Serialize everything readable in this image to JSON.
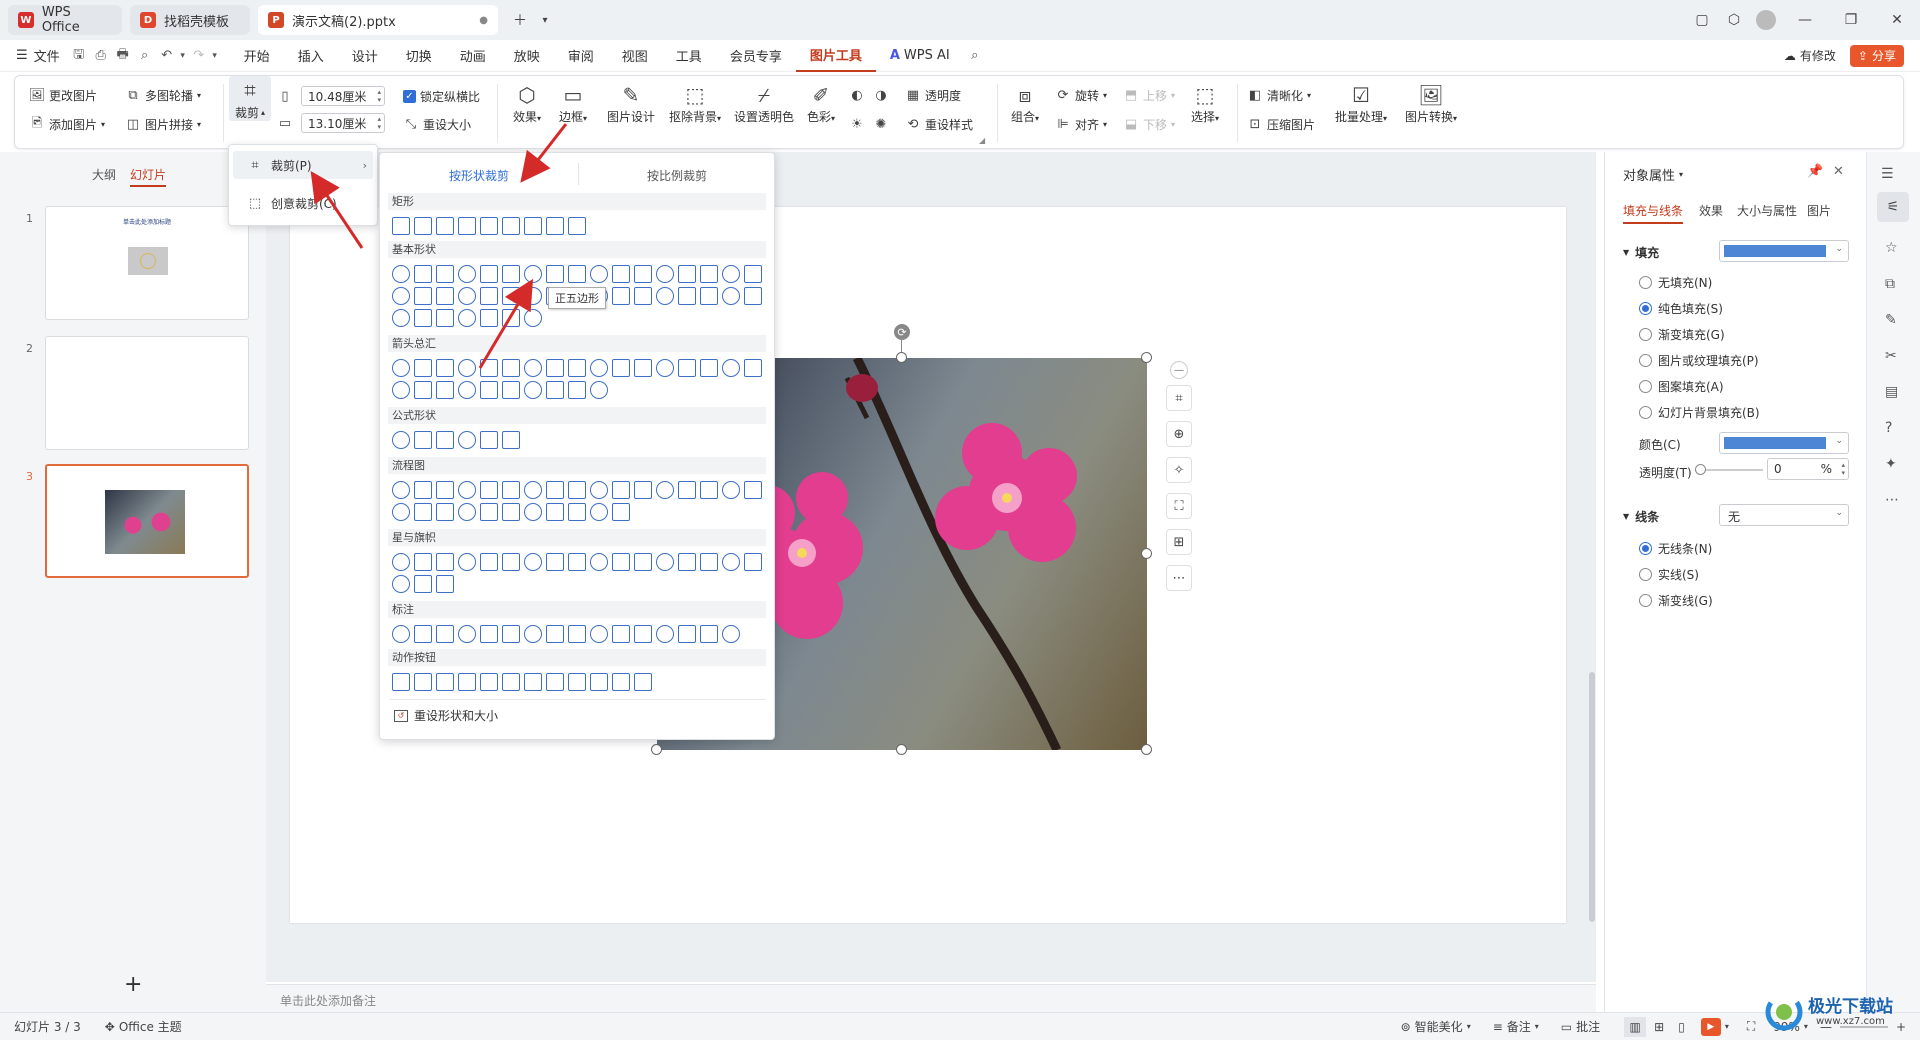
{
  "tabs": [
    {
      "label": "WPS Office",
      "icon": "W"
    },
    {
      "label": "找稻壳模板",
      "icon": "D"
    },
    {
      "label": "演示文稿(2).pptx",
      "icon": "P"
    }
  ],
  "menu": {
    "file_label": "文件",
    "items": [
      "开始",
      "插入",
      "设计",
      "切换",
      "动画",
      "放映",
      "审阅",
      "视图",
      "工具",
      "会员专享",
      "图片工具"
    ],
    "active": "图片工具",
    "wps_ai": "WPS AI",
    "has_changes": "有修改",
    "share": "分享"
  },
  "ribbon": {
    "change_pic": "更改图片",
    "multi_carousel": "多图轮播",
    "add_pic": "添加图片",
    "pic_collage": "图片拼接",
    "crop": "裁剪",
    "width": "10.48厘米",
    "height": "13.10厘米",
    "lock_ratio": "锁定纵横比",
    "reset_size": "重设大小",
    "effects": "效果",
    "border": "边框",
    "pic_design": "图片设计",
    "remove_bg": "抠除背景",
    "set_transparent": "设置透明色",
    "color": "色彩",
    "transparency": "透明度",
    "reset_style": "重设样式",
    "group": "组合",
    "rotate": "旋转",
    "align": "对齐",
    "bring_up": "上移",
    "send_down": "下移",
    "select": "选择",
    "sharpen": "清晰化",
    "compress": "压缩图片",
    "batch": "批量处理",
    "convert": "图片转换"
  },
  "crop_menu": {
    "crop_item": "裁剪(P)",
    "creative_crop": "创意裁剪(C)"
  },
  "shape_panel": {
    "tab_shape": "按形状裁剪",
    "tab_ratio": "按比例裁剪",
    "sections": [
      "矩形",
      "基本形状",
      "箭头总汇",
      "公式形状",
      "流程图",
      "星与旗帜",
      "标注",
      "动作按钮"
    ],
    "tooltip": "正五边形",
    "reset": "重设形状和大小"
  },
  "left_panel": {
    "tab_outline": "大纲",
    "tab_slides": "幻灯片",
    "slides": [
      {
        "number": "1",
        "title": "单击此处添加标题"
      },
      {
        "number": "2",
        "title": ""
      },
      {
        "number": "3",
        "title": ""
      }
    ],
    "add_slide": "+"
  },
  "notes_placeholder": "单击此处添加备注",
  "right_panel": {
    "title": "对象属性",
    "tabs": [
      "填充与线条",
      "效果",
      "大小与属性",
      "图片"
    ],
    "fill_header": "填充",
    "fill_options": [
      "无填充(N)",
      "纯色填充(S)",
      "渐变填充(G)",
      "图片或纹理填充(P)",
      "图案填充(A)",
      "幻灯片背景填充(B)"
    ],
    "fill_selected": "纯色填充(S)",
    "color_label": "颜色(C)",
    "transparency_label": "透明度(T)",
    "transparency_value": "0",
    "transparency_unit": "%",
    "fill_color": "#4e86d6",
    "line_header": "线条",
    "line_value": "无",
    "line_options": [
      "无线条(N)",
      "实线(S)",
      "渐变线(G)"
    ],
    "line_selected": "无线条(N)"
  },
  "status": {
    "slide_info": "幻灯片 3 / 3",
    "theme": "Office 主题",
    "smart_beautify": "智能美化",
    "notes": "备注",
    "comments": "批注",
    "zoom": "99%"
  },
  "watermark": {
    "site": "极光下载站",
    "url": "www.xz7.com"
  },
  "colors": {
    "accent": "#c43c1e",
    "selection": "#e36a3b",
    "shape_stroke": "#3d6fc6",
    "arrow": "#d42a2a"
  }
}
